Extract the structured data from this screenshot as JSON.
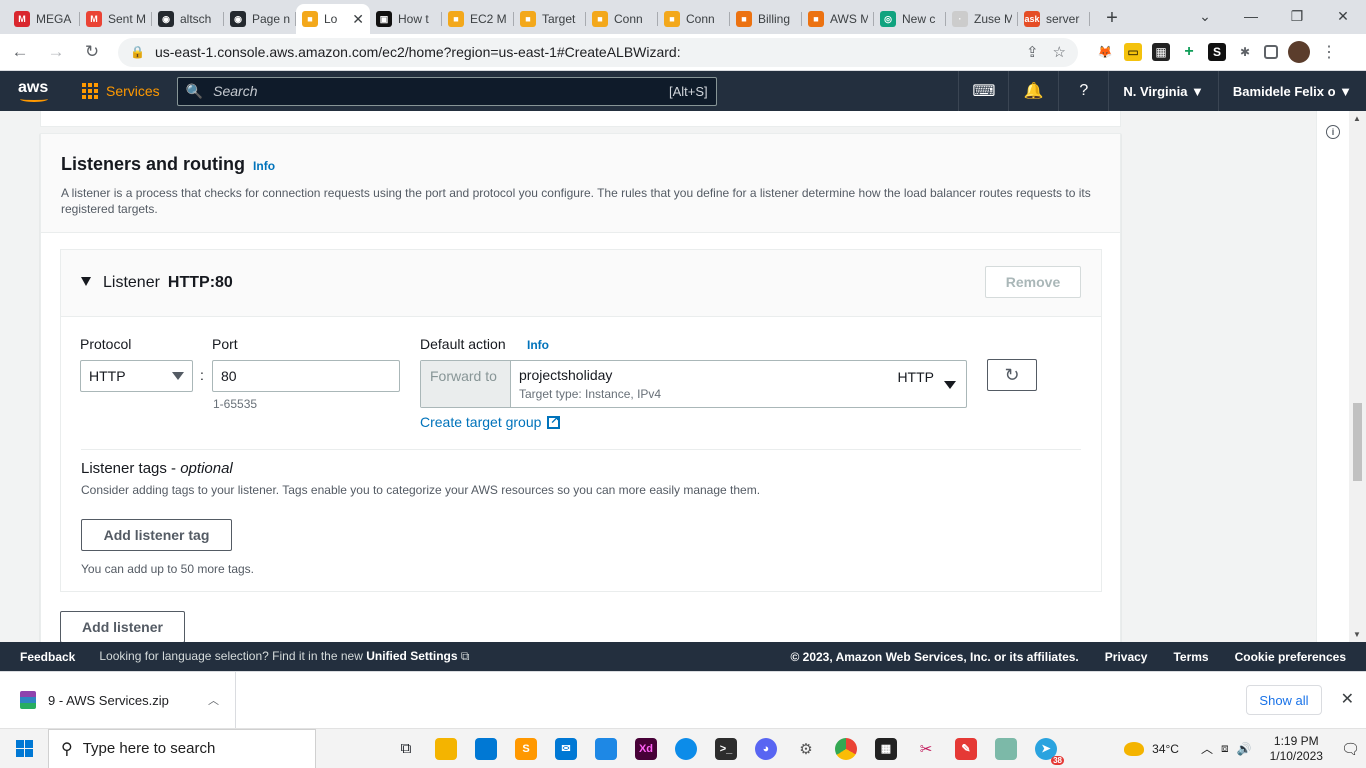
{
  "browser": {
    "tabs": [
      {
        "title": "MEGA",
        "color": "#d9272e",
        "glyph": "M"
      },
      {
        "title": "Sent M",
        "color": "#ea4335",
        "glyph": "M"
      },
      {
        "title": "altsch",
        "color": "#24292f",
        "glyph": "◉"
      },
      {
        "title": "Page n",
        "color": "#24292f",
        "glyph": "◉"
      },
      {
        "title": "Lo",
        "color": "#f3a81b",
        "glyph": "■",
        "active": true
      },
      {
        "title": "How t",
        "color": "#111111",
        "glyph": "▣"
      },
      {
        "title": "EC2 M",
        "color": "#f3a81b",
        "glyph": "■"
      },
      {
        "title": "Target",
        "color": "#f3a81b",
        "glyph": "■"
      },
      {
        "title": "Conn",
        "color": "#f3a81b",
        "glyph": "■"
      },
      {
        "title": "Conn",
        "color": "#f3a81b",
        "glyph": "■"
      },
      {
        "title": "Billing",
        "color": "#ec7211",
        "glyph": "■"
      },
      {
        "title": "AWS M",
        "color": "#ec7211",
        "glyph": "■"
      },
      {
        "title": "New c",
        "color": "#10a37f",
        "glyph": "◎"
      },
      {
        "title": "Zuse M",
        "color": "#cccccc",
        "glyph": "·"
      },
      {
        "title": "server",
        "color": "#e54d26",
        "glyph": "ask"
      }
    ],
    "url": "us-east-1.console.aws.amazon.com/ec2/home?region=us-east-1#CreateALBWizard:"
  },
  "aws_nav": {
    "logo": "aws",
    "services": "Services",
    "search_placeholder": "Search",
    "search_shortcut": "[Alt+S]",
    "region": "N. Virginia ▼",
    "account": "Bamidele Felix o ▼"
  },
  "section": {
    "title": "Listeners and routing",
    "info": "Info",
    "description": "A listener is a process that checks for connection requests using the port and protocol you configure. The rules that you define for a listener determine how the load balancer routes requests to its registered targets."
  },
  "listener": {
    "label": "Listener",
    "name": "HTTP:80",
    "remove": "Remove",
    "protocol_label": "Protocol",
    "protocol_value": "HTTP",
    "colon": ":",
    "port_label": "Port",
    "port_value": "80",
    "port_hint": "1-65535",
    "default_action_label": "Default action",
    "default_action_info": "Info",
    "forward_to": "Forward to",
    "target_group": "projectsholiday",
    "target_type": "Target type: Instance, IPv4",
    "target_protocol": "HTTP",
    "create_target_group": "Create target group",
    "tags_title": "Listener tags - ",
    "tags_optional": "optional",
    "tags_desc": "Consider adding tags to your listener. Tags enable you to categorize your AWS resources so you can more easily manage them.",
    "add_tag": "Add listener tag",
    "tags_limit": "You can add up to 50 more tags."
  },
  "add_listener": "Add listener",
  "footer": {
    "feedback": "Feedback",
    "lang_text": "Looking for language selection? Find it in the new ",
    "lang_link": "Unified Settings",
    "copyright": "© 2023, Amazon Web Services, Inc. or its affiliates.",
    "privacy": "Privacy",
    "terms": "Terms",
    "cookies": "Cookie preferences"
  },
  "downloads": {
    "file": "9 - AWS Services.zip",
    "show_all": "Show all"
  },
  "taskbar": {
    "search_placeholder": "Type here to search",
    "temperature": "34°C",
    "time": "1:19 PM",
    "date": "1/10/2023",
    "telegram_badge": "38"
  }
}
